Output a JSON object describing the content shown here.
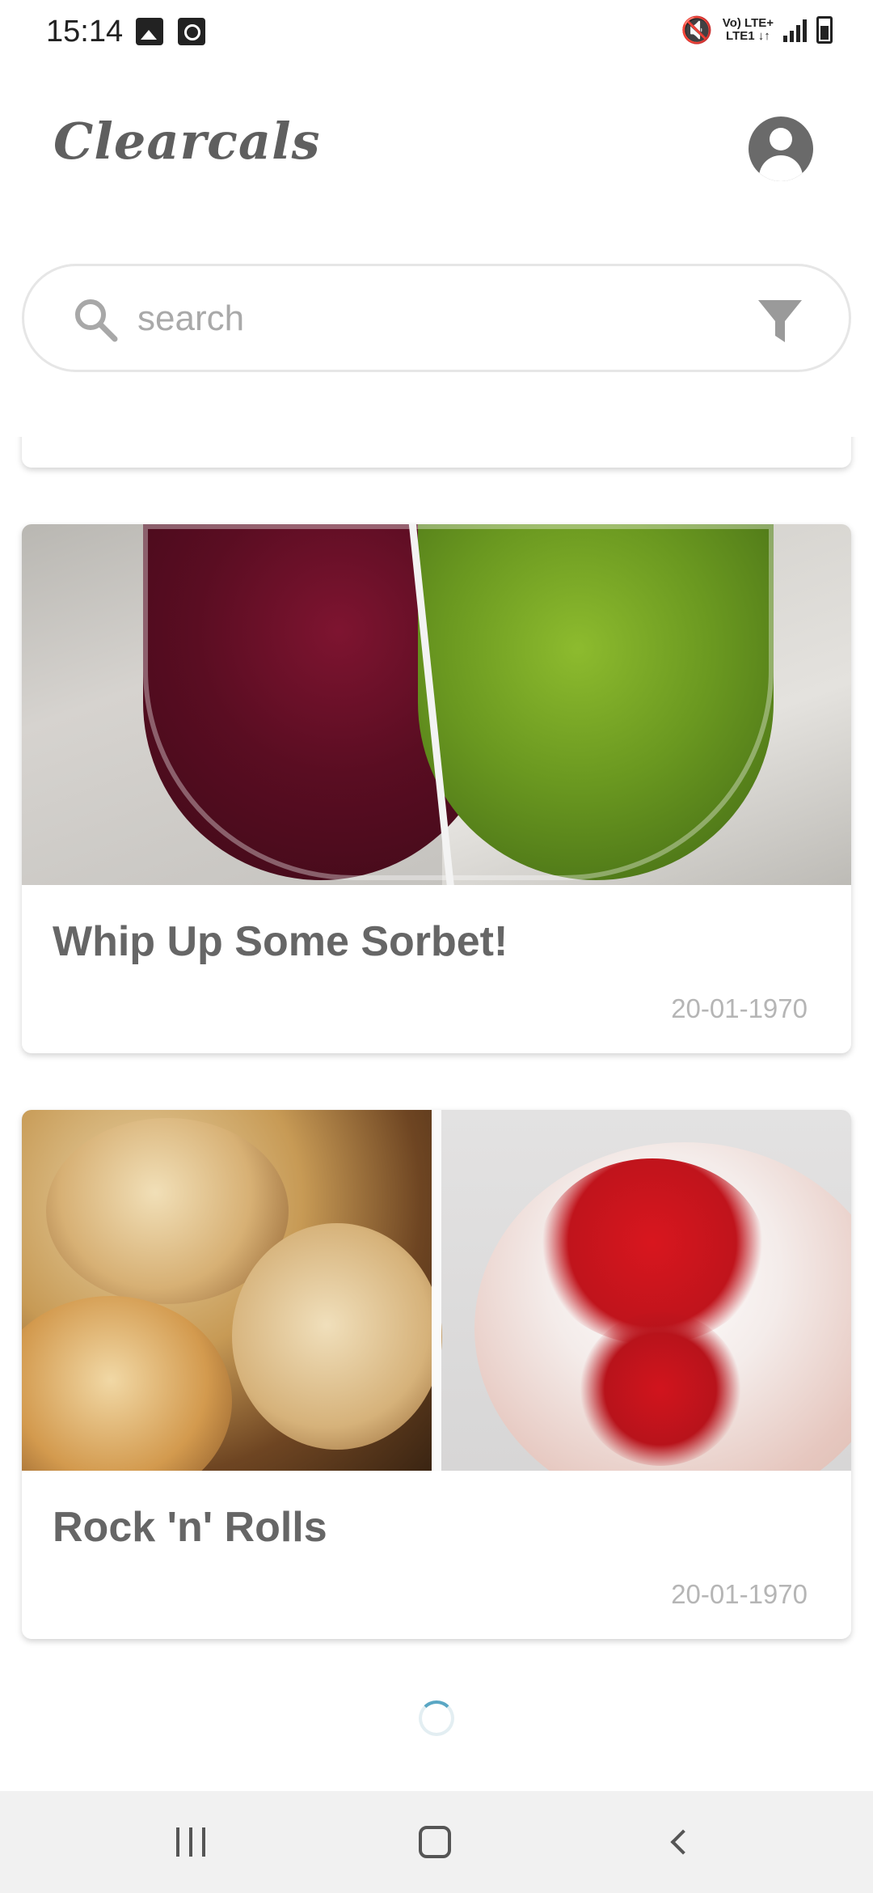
{
  "status_bar": {
    "time": "15:14",
    "network_line1": "Vo) LTE+",
    "network_line2": "LTE1 ↓↑"
  },
  "app": {
    "title": "Clearcals",
    "profile_icon": "account-circle-icon"
  },
  "search": {
    "placeholder": "search",
    "value": "",
    "search_icon": "search-icon",
    "filter_icon": "filter-icon"
  },
  "feed": {
    "items": [
      {
        "title": "Whip Up Some Sorbet!",
        "date": "20-01-1970"
      },
      {
        "title": "Rock 'n' Rolls",
        "date": "20-01-1970"
      }
    ]
  },
  "colors": {
    "accent": "#5aa7c4",
    "title_text": "#666666",
    "date_text": "#b5b5b5",
    "nav_bar_bg": "#f1f1f1"
  }
}
